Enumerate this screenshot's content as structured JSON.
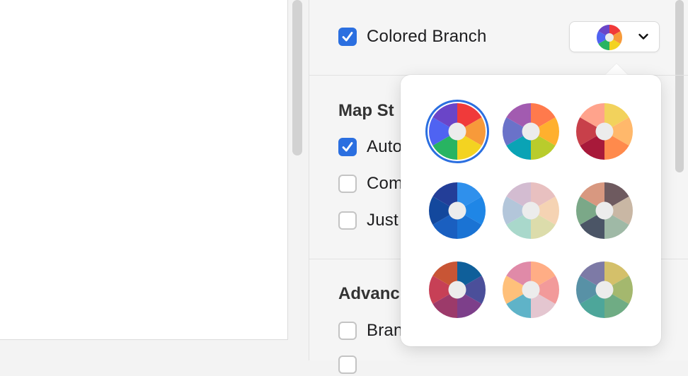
{
  "panel": {
    "colored_branch": {
      "label": "Colored Branch",
      "checked": true
    },
    "map_style": {
      "title": "Map St",
      "options": [
        {
          "label": "Auto",
          "checked": true
        },
        {
          "label": "Com",
          "checked": false
        },
        {
          "label": "Just",
          "checked": false
        }
      ]
    },
    "advanced": {
      "title": "Advanc",
      "options": [
        {
          "label": "Bran",
          "checked": false
        }
      ]
    }
  },
  "branch_select": {
    "selected_palette": 0,
    "icon": "chevron-down-icon"
  },
  "palettes": [
    {
      "name": "rainbow",
      "colors": [
        "#f03a3a",
        "#f79a3a",
        "#f3d321",
        "#28b462",
        "#4f63f2",
        "#6a45c8"
      ]
    },
    {
      "name": "vivid",
      "colors": [
        "#ff7a4c",
        "#ffb02e",
        "#b9cc2c",
        "#0aa3b5",
        "#6a72c9",
        "#a25bb0"
      ]
    },
    {
      "name": "warm",
      "colors": [
        "#f2d25c",
        "#ffb86b",
        "#ff8a4c",
        "#a8193a",
        "#c8404a",
        "#ffa38c"
      ]
    },
    {
      "name": "blues",
      "colors": [
        "#2f90ec",
        "#1f86e6",
        "#1a73d4",
        "#1a5fc0",
        "#13489d",
        "#233e98"
      ]
    },
    {
      "name": "pastel",
      "colors": [
        "#e8c0c0",
        "#f5d3b3",
        "#dcdcab",
        "#a9d8cb",
        "#b3c6da",
        "#d3bcd1"
      ]
    },
    {
      "name": "earth",
      "colors": [
        "#6e5a5f",
        "#c9b7a4",
        "#9fb9a6",
        "#4b5566",
        "#7ba888",
        "#d89880"
      ]
    },
    {
      "name": "berry",
      "colors": [
        "#0f5f9a",
        "#4b4f9a",
        "#7d3f8a",
        "#9c3a6a",
        "#c74056",
        "#c85535"
      ]
    },
    {
      "name": "candy",
      "colors": [
        "#ffad85",
        "#f29a9a",
        "#e4c6d0",
        "#5fb3c8",
        "#ffc07a",
        "#e08aa8"
      ]
    },
    {
      "name": "muted",
      "colors": [
        "#d4c06a",
        "#a4b86e",
        "#6fac84",
        "#4da69a",
        "#5891a6",
        "#7d7aa6"
      ]
    }
  ]
}
